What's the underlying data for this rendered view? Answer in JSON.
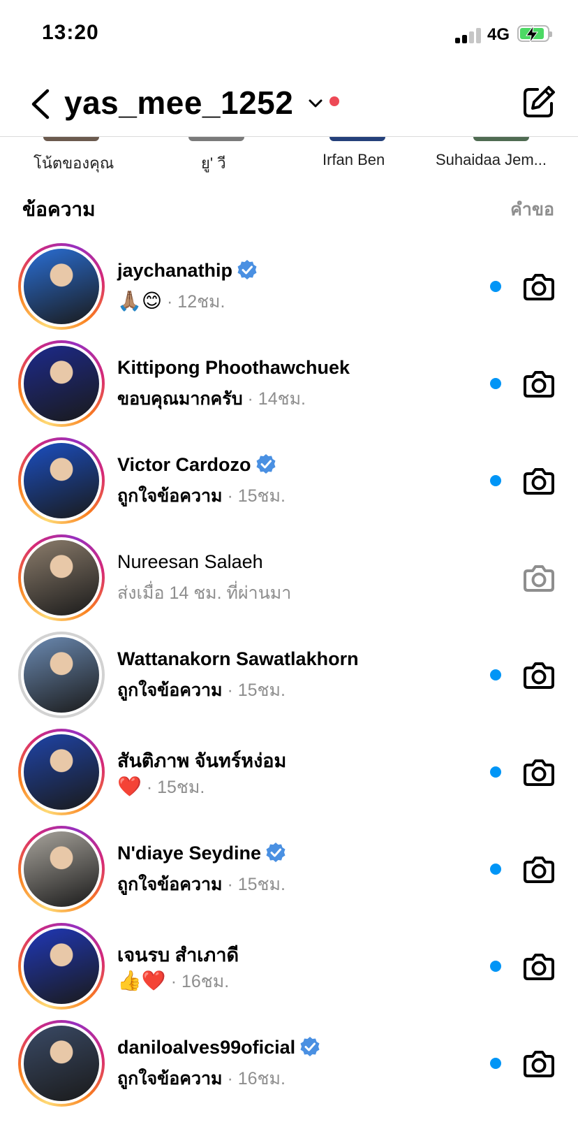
{
  "status_bar": {
    "time": "13:20",
    "network": "4G"
  },
  "header": {
    "username": "yas_mee_1252"
  },
  "notes": [
    {
      "label": "โน้ตของคุณ"
    },
    {
      "label": "ยู' วี"
    },
    {
      "label": "Irfan Ben"
    },
    {
      "label": "Suhaidaa Jem..."
    }
  ],
  "section": {
    "title": "ข้อความ",
    "requests": "คำขอ"
  },
  "conversations": [
    {
      "name": "jaychanathip",
      "verified": true,
      "unread": true,
      "message": "🙏🏽😊",
      "time": "· 12ชม.",
      "avatar_color": "#2a6fd6"
    },
    {
      "name": "Kittipong Phoothawchuek",
      "verified": false,
      "unread": true,
      "message": "ขอบคุณมากครับ",
      "time": "· 14ชม.",
      "avatar_color": "#1d2a8c"
    },
    {
      "name": "Victor Cardozo",
      "verified": true,
      "unread": true,
      "message": "ถูกใจข้อความ",
      "time": "· 15ชม.",
      "avatar_color": "#1b4fc2"
    },
    {
      "name": "Nureesan Salaeh",
      "verified": false,
      "unread": false,
      "message": "ส่งเมื่อ 14 ชม. ที่ผ่านมา",
      "time": "",
      "avatar_color": "#8c7d6c"
    },
    {
      "name": "Wattanakorn Sawatlakhorn",
      "verified": false,
      "unread": true,
      "message": "ถูกใจข้อความ",
      "time": "· 15ชม.",
      "avatar_color": "#6b8ab2"
    },
    {
      "name": "สันติภาพ จันทร์หง่อม",
      "verified": false,
      "unread": true,
      "message": "❤️",
      "time": "· 15ชม.",
      "avatar_color": "#1f44a8"
    },
    {
      "name": "N'diaye Seydine",
      "verified": true,
      "unread": true,
      "message": "ถูกใจข้อความ",
      "time": "· 15ชม.",
      "avatar_color": "#a8a49c"
    },
    {
      "name": "เจนรบ สำเภาดี",
      "verified": false,
      "unread": true,
      "message": "👍❤️",
      "time": "· 16ชม.",
      "avatar_color": "#2038b8"
    },
    {
      "name": "daniloalves99oficial",
      "verified": true,
      "unread": true,
      "message": "ถูกใจข้อความ",
      "time": "· 16ชม.",
      "avatar_color": "#3a4a66"
    }
  ],
  "colors": {
    "accent_blue": "#0095f6",
    "notification_red": "#ed4956",
    "verified_blue": "#4a90e2"
  }
}
